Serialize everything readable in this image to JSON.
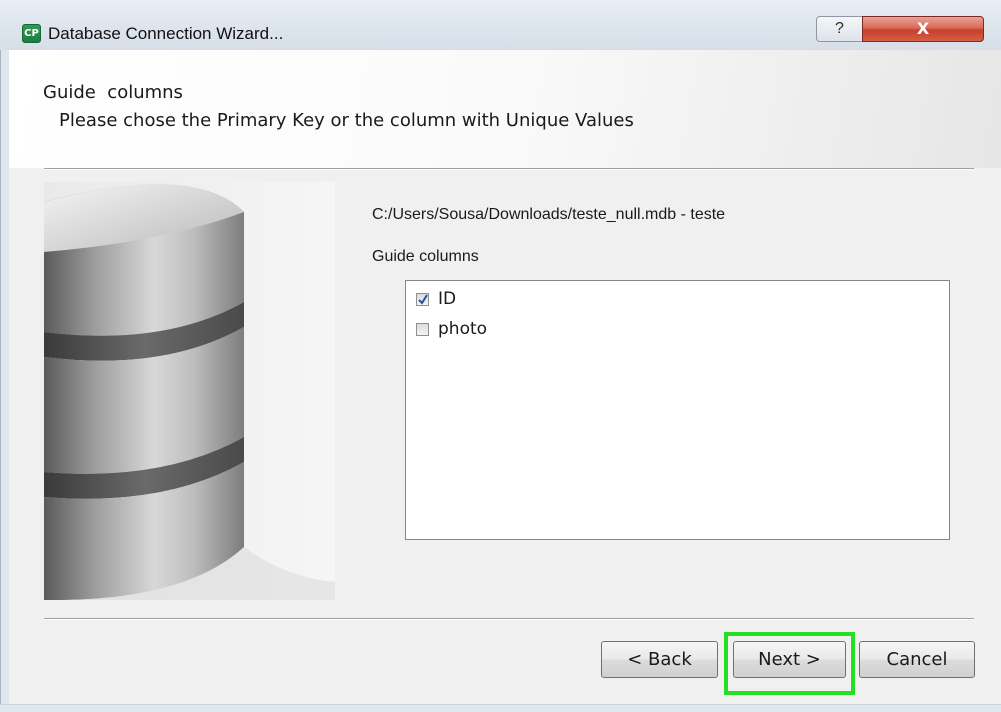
{
  "window": {
    "title": "Database Connection Wizard...",
    "app_icon_text": "CP",
    "help_glyph": "?",
    "close_glyph": "X"
  },
  "header": {
    "title": "Guide  columns",
    "subtitle": "Please chose the Primary Key or the column with Unique Values"
  },
  "content": {
    "path": "C:/Users/Sousa/Downloads/teste_null.mdb - teste",
    "guide_label": "Guide columns",
    "columns": [
      {
        "label": "ID",
        "checked": true
      },
      {
        "label": "photo",
        "checked": false
      }
    ]
  },
  "buttons": {
    "back": "< Back",
    "next": "Next >",
    "cancel": "Cancel"
  },
  "colors": {
    "highlight": "#22e022",
    "close_red": "#c7402d"
  }
}
